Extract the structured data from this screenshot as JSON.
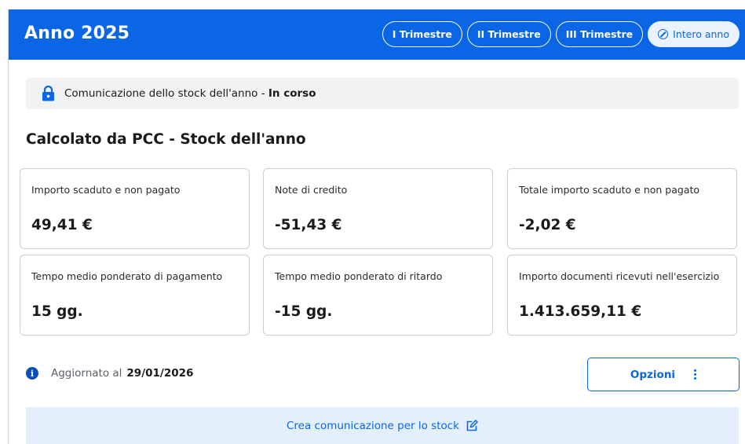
{
  "header": {
    "title": "Anno 2025",
    "tabs": [
      {
        "label": "I Trimestre",
        "active": false
      },
      {
        "label": "II Trimestre",
        "active": false
      },
      {
        "label": "III Trimestre",
        "active": false
      },
      {
        "label": "Intero anno",
        "active": true
      }
    ]
  },
  "status": {
    "icon": "lock-icon",
    "text": "Comunicazione dello stock dell'anno",
    "separator": " - ",
    "state": "In corso"
  },
  "section": {
    "title": "Calcolato da PCC - Stock dell'anno"
  },
  "cards": [
    {
      "label": "Importo scaduto e non pagato",
      "value": "49,41 €"
    },
    {
      "label": "Note di credito",
      "value": "-51,43 €"
    },
    {
      "label": "Totale importo scaduto e non pagato",
      "value": "-2,02 €"
    },
    {
      "label": "Tempo medio ponderato di pagamento",
      "value": "15 gg."
    },
    {
      "label": "Tempo medio ponderato di ritardo",
      "value": "-15 gg."
    },
    {
      "label": "Importo documenti ricevuti nell'esercizio",
      "value": "1.413.659,11 €"
    }
  ],
  "update": {
    "icon": "info-icon",
    "label": "Aggiornato al",
    "date": "29/01/2026"
  },
  "options_button": {
    "label": "Opzioni",
    "icon": "kebab-menu-icon"
  },
  "create_action": {
    "label": "Crea comunicazione per lo stock",
    "icon": "edit-icon"
  },
  "colors": {
    "primary": "#0a66e4",
    "status_bg": "#f1f2f4",
    "action_bg": "#e3f0fc"
  }
}
